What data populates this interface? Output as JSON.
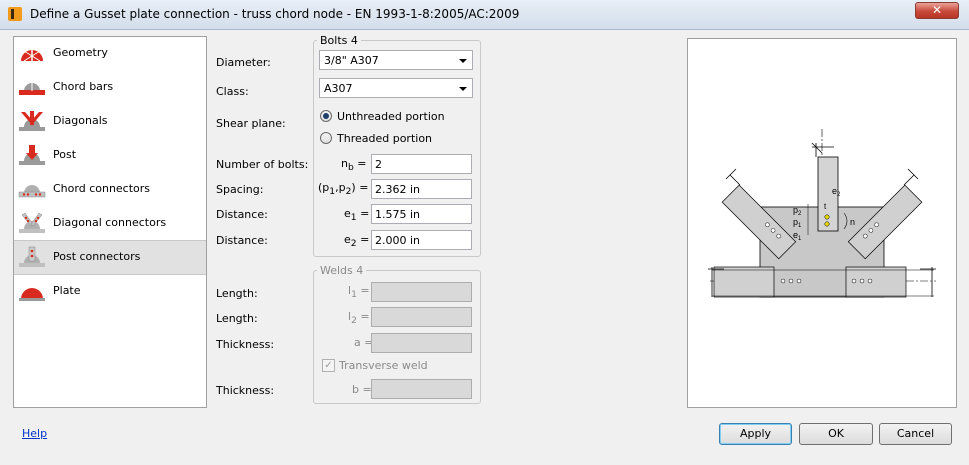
{
  "window": {
    "title": "Define a Gusset plate connection - truss chord node - EN 1993-1-8:2005/AC:2009",
    "close_glyph": "✕"
  },
  "sidebar": {
    "items": [
      {
        "label": "Geometry",
        "icon": "geometry-icon"
      },
      {
        "label": "Chord bars",
        "icon": "chord-bars-icon"
      },
      {
        "label": "Diagonals",
        "icon": "diagonals-icon"
      },
      {
        "label": "Post",
        "icon": "post-icon"
      },
      {
        "label": "Chord connectors",
        "icon": "chord-connectors-icon"
      },
      {
        "label": "Diagonal connectors",
        "icon": "diagonal-connectors-icon"
      },
      {
        "label": "Post connectors",
        "icon": "post-connectors-icon",
        "selected": true
      },
      {
        "label": "Plate",
        "icon": "plate-icon"
      }
    ]
  },
  "bolts": {
    "group_title": "Bolts 4",
    "diameter_label": "Diameter:",
    "diameter_value": "3/8\" A307",
    "class_label": "Class:",
    "class_value": "A307",
    "shear_plane_label": "Shear plane:",
    "shear_options": [
      {
        "label": "Unthreaded portion",
        "selected": true
      },
      {
        "label": "Threaded portion",
        "selected": false
      }
    ],
    "num_bolts_label": "Number of bolts:",
    "num_bolts_symbol": "n",
    "num_bolts_sub": "b",
    "num_bolts_value": "2",
    "spacing_label": "Spacing:",
    "spacing_symbol": "(p",
    "spacing_sub1": "1",
    "spacing_mid": ",p",
    "spacing_sub2": "2",
    "spacing_end": ") =",
    "spacing_value": "2.362 in",
    "distance1_label": "Distance:",
    "distance1_symbol": "e",
    "distance1_sub": "1",
    "distance1_value": "1.575 in",
    "distance2_label": "Distance:",
    "distance2_symbol": "e",
    "distance2_sub": "2",
    "distance2_value": "2.000 in",
    "equals": "="
  },
  "welds": {
    "group_title": "Welds 4",
    "length1_label": "Length:",
    "length1_symbol": "l",
    "length1_sub": "1",
    "length2_label": "Length:",
    "length2_symbol": "l",
    "length2_sub": "2",
    "thickness1_label": "Thickness:",
    "thickness1_symbol": "a",
    "transverse_label": "Transverse weld",
    "transverse_checked": true,
    "thickness2_label": "Thickness:",
    "thickness2_symbol": "b",
    "equals": "=",
    "check_glyph": "✓"
  },
  "drawing_labels": {
    "e2": "e",
    "e2_sub": "2",
    "p2": "p",
    "p2_sub": "2",
    "p1": "p",
    "p1_sub": "1",
    "e1": "e",
    "e1_sub": "1",
    "n": "n",
    "t": "t"
  },
  "footer": {
    "help": "Help",
    "apply": "Apply",
    "ok": "OK",
    "cancel": "Cancel"
  },
  "colors": {
    "icon_red": "#d82a1e",
    "icon_gray": "#9a9a9a",
    "drawing_gray": "#c8c8c8",
    "bolt_yellow": "#e8d800"
  }
}
